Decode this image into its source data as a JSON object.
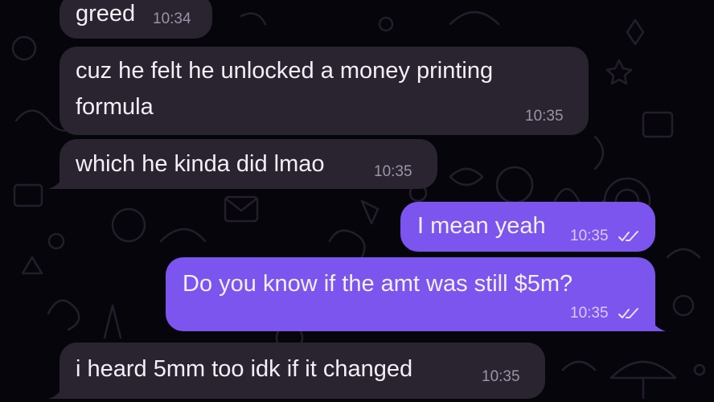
{
  "messages": [
    {
      "id": "m1",
      "direction": "incoming",
      "text": "greed",
      "time": "10:34"
    },
    {
      "id": "m2",
      "direction": "incoming",
      "text_lines": [
        "cuz he felt he unlocked a money printing",
        "formula"
      ],
      "time": "10:35"
    },
    {
      "id": "m3",
      "direction": "incoming",
      "text": "which he kinda did lmao",
      "time": "10:35"
    },
    {
      "id": "m4",
      "direction": "outgoing",
      "text": "I mean yeah",
      "time": "10:35",
      "status_icon": "double-check-icon"
    },
    {
      "id": "m5",
      "direction": "outgoing",
      "text": "Do you know if the amt was still $5m?",
      "time": "10:35",
      "status_icon": "double-check-icon"
    },
    {
      "id": "m6",
      "direction": "incoming",
      "text": "i heard 5mm too idk if it changed",
      "time": "10:35"
    }
  ],
  "colors": {
    "background": "#07050c",
    "incoming_bubble": "#2a2330",
    "outgoing_bubble": "#7b55ee",
    "text": "#f2eff7",
    "pattern": "#241d2c"
  }
}
